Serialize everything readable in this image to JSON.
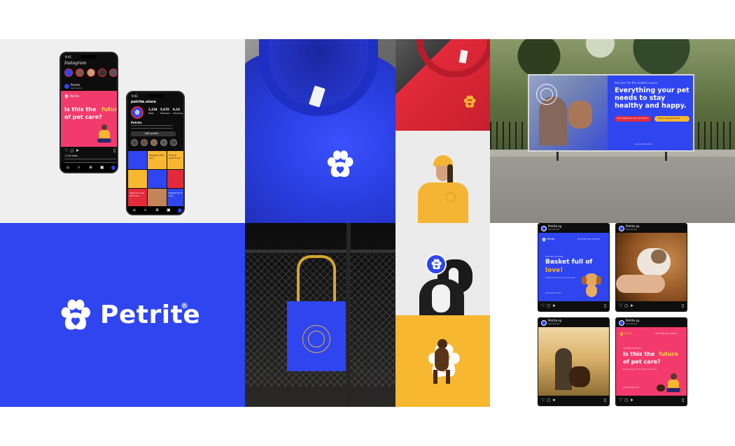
{
  "brand": {
    "name": "Petrite",
    "registered_mark": "®",
    "colors": {
      "blue": "#2f45f0",
      "red": "#e22a3a",
      "yellow": "#f7b731",
      "white": "#ffffff"
    }
  },
  "phone_feed": {
    "status_time": "9:41",
    "app_name": "Instagram",
    "account": "Petrite",
    "sponsored": "Sponsored",
    "post_brand": "Petrite",
    "headline_part1": "Is this the",
    "headline_highlight": "future",
    "headline_part2": "of pet care?",
    "likes": "1,234 likes"
  },
  "phone_profile": {
    "status_time": "9:41",
    "handle": "petrite.store",
    "stats": [
      {
        "value": "1,234",
        "label": "Posts"
      },
      {
        "value": "5,678",
        "label": "Followers"
      },
      {
        "value": "9,10",
        "label": "Following"
      }
    ],
    "bio_name": "Petrite",
    "button": "Edit profile",
    "grid_texts": [
      "Designed with love",
      "Finding perfect pet",
      "Treat your pet with love",
      "Basket full of love"
    ]
  },
  "billboard": {
    "small_heading": "Pet-care for the modern owner",
    "headline": "Everything your pet needs to stay healthy and happy.",
    "cta_primary": "Shop supplies for your furry friend",
    "cta_secondary": "Book a vet appointment",
    "website": "www.petrite.store"
  },
  "posts": [
    {
      "account": "Petrite.sg",
      "sponsored": "Sponsored",
      "top_brand": "Petrite",
      "top_tagline": "PETSTORE AND SUPPLIES",
      "kicker": "GETTING STARTED",
      "headline_part1": "Basket full of",
      "headline_highlight": "love!",
      "subtext": "Quality pet food and accessories",
      "footer_link": "www.petrite.store"
    },
    {
      "account": "Petrite.sg",
      "sponsored": "Sponsored"
    },
    {
      "account": "Petrite.sg",
      "sponsored": "Sponsored"
    },
    {
      "account": "Petrite.sg",
      "sponsored": "Sponsored",
      "top_brand": "Petrite",
      "top_tagline": "PETSTORE AND SUPPLIES",
      "kicker": "GETTING STARTED",
      "headline_part1": "Is this the",
      "headline_highlight": "future",
      "headline_part2": "of pet care?",
      "subtext": "Everything your pet needs, in one place",
      "footer_link": "www.petrite.store"
    }
  ],
  "icons": [
    "paw-logo-icon",
    "heart-icon",
    "comment-icon",
    "share-icon",
    "bookmark-icon",
    "home-icon",
    "search-icon",
    "reels-icon",
    "profile-icon"
  ]
}
